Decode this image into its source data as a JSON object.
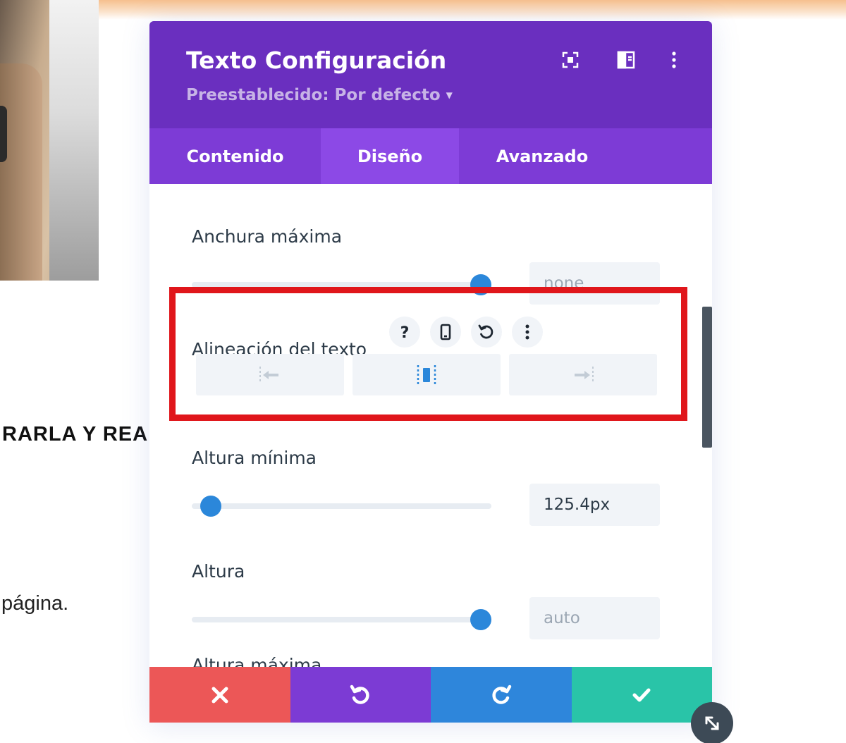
{
  "background": {
    "heading_fragment": "RARLA Y REA",
    "text_fragment": "página."
  },
  "modal": {
    "title": "Texto Configuración",
    "preset_label": "Preestablecido: Por defecto",
    "header_icons": [
      "fullscreen-icon",
      "split-view-icon",
      "more-options-icon"
    ],
    "tabs": [
      {
        "label": "Contenido",
        "active": false
      },
      {
        "label": "Diseño",
        "active": true
      },
      {
        "label": "Avanzado",
        "active": false
      }
    ],
    "settings": {
      "max_width": {
        "label": "Anchura máxima",
        "value": "none",
        "slider_level": 1.0
      },
      "text_alignment": {
        "label": "Alineación del texto",
        "icons": [
          "help-icon",
          "responsive-phone-icon",
          "reset-icon",
          "more-options-icon"
        ],
        "options": [
          "align-left-icon",
          "align-center-icon",
          "align-right-icon"
        ]
      },
      "min_height": {
        "label": "Altura mínima",
        "value": "125.4px",
        "slider_level": 0.06
      },
      "height": {
        "label": "Altura",
        "value": "auto",
        "slider_level": 1.0
      },
      "max_height": {
        "label": "Altura máxima"
      }
    },
    "footer": [
      "close-icon",
      "undo-icon",
      "redo-icon",
      "check-icon"
    ]
  },
  "colors": {
    "header": "#6a2fbf",
    "tabs": "#7d3bd6",
    "active_tab": "#8c49e6",
    "highlight": "#e0161b",
    "cancel": "#ec5757",
    "undo": "#7c3bd4",
    "redo": "#2e86db",
    "save": "#29c4a8",
    "slider_knob": "#2b87da"
  }
}
